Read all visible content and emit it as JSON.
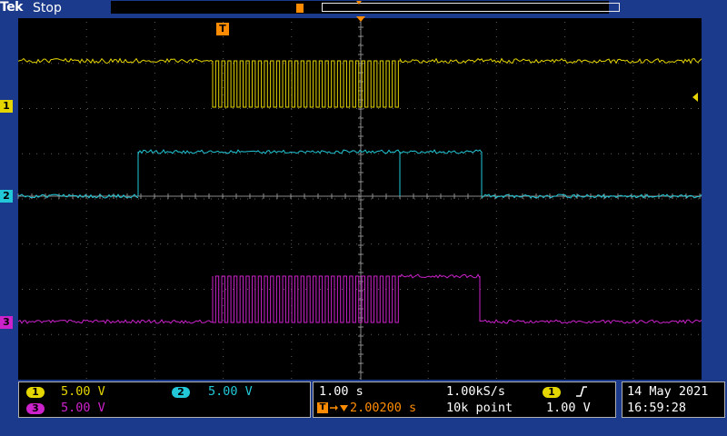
{
  "header": {
    "brand": "Tek",
    "status": "Stop"
  },
  "trigger_marker": "T",
  "channels": [
    {
      "id": "1",
      "color": "#e6d600",
      "scale": "5.00 V"
    },
    {
      "id": "2",
      "color": "#22c8d8",
      "scale": "5.00 V"
    },
    {
      "id": "3",
      "color": "#cc22cc",
      "scale": "5.00 V"
    }
  ],
  "horizontal": {
    "timebase": "1.00 s",
    "sample_rate": "1.00kS/s",
    "delay": "2.00200 s",
    "record_length": "10k point"
  },
  "trigger": {
    "source": "1",
    "level": "1.00 V"
  },
  "datetime": {
    "date": "14 May 2021",
    "time": "16:59:28"
  }
}
